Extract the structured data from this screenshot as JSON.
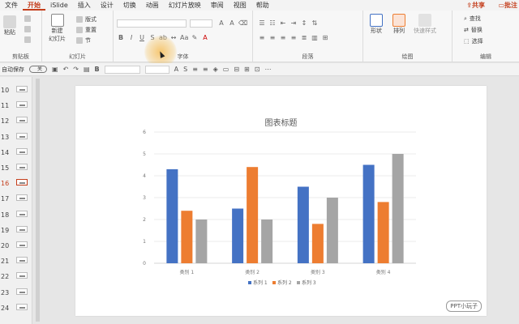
{
  "menu": {
    "items": [
      "文件",
      "开始",
      "iSlide",
      "插入",
      "设计",
      "切换",
      "动画",
      "幻灯片放映",
      "审阅",
      "视图",
      "帮助"
    ],
    "active_index": 1,
    "share": "共享",
    "comment": "批注"
  },
  "ribbon": {
    "clipboard": {
      "paste": "粘贴",
      "label": "剪贴板"
    },
    "slides": {
      "new_slide_line1": "新建",
      "new_slide_line2": "幻灯片",
      "layout": "版式",
      "reset": "重置",
      "section": "节",
      "label": "幻灯片"
    },
    "font": {
      "label": "字体",
      "bold": "B",
      "italic": "I",
      "underline": "U",
      "strike": "S"
    },
    "paragraph": {
      "label": "段落"
    },
    "drawing": {
      "shapes": "形状",
      "arrange": "排列",
      "quick_styles": "快速样式",
      "label": "绘图"
    },
    "editing": {
      "find": "查找",
      "replace": "替换",
      "select": "选择",
      "label": "编辑"
    }
  },
  "qat": {
    "autosave": "自动保存",
    "toggle": "关"
  },
  "slide_panel": {
    "numbers": [
      "10",
      "11",
      "12",
      "13",
      "14",
      "15",
      "16",
      "17",
      "18",
      "19",
      "20",
      "21",
      "22",
      "23",
      "24"
    ],
    "current": "16"
  },
  "colors": {
    "accent": "#c43e1c",
    "series1": "#4472c4",
    "series2": "#ed7d31",
    "series3": "#a5a5a5"
  },
  "chart_data": {
    "type": "bar",
    "title": "图表标题",
    "categories": [
      "类别 1",
      "类别 2",
      "类别 3",
      "类别 4"
    ],
    "series": [
      {
        "name": "系列 1",
        "values": [
          4.3,
          2.5,
          3.5,
          4.5
        ]
      },
      {
        "name": "系列 2",
        "values": [
          2.4,
          4.4,
          1.8,
          2.8
        ]
      },
      {
        "name": "系列 3",
        "values": [
          2.0,
          2.0,
          3.0,
          5.0
        ]
      }
    ],
    "ylim": [
      0,
      6
    ],
    "yticks": [
      "0",
      "1",
      "2",
      "3",
      "4",
      "5",
      "6"
    ],
    "grid": true,
    "legend": "bottom"
  },
  "watermark": "PPT小玩子"
}
